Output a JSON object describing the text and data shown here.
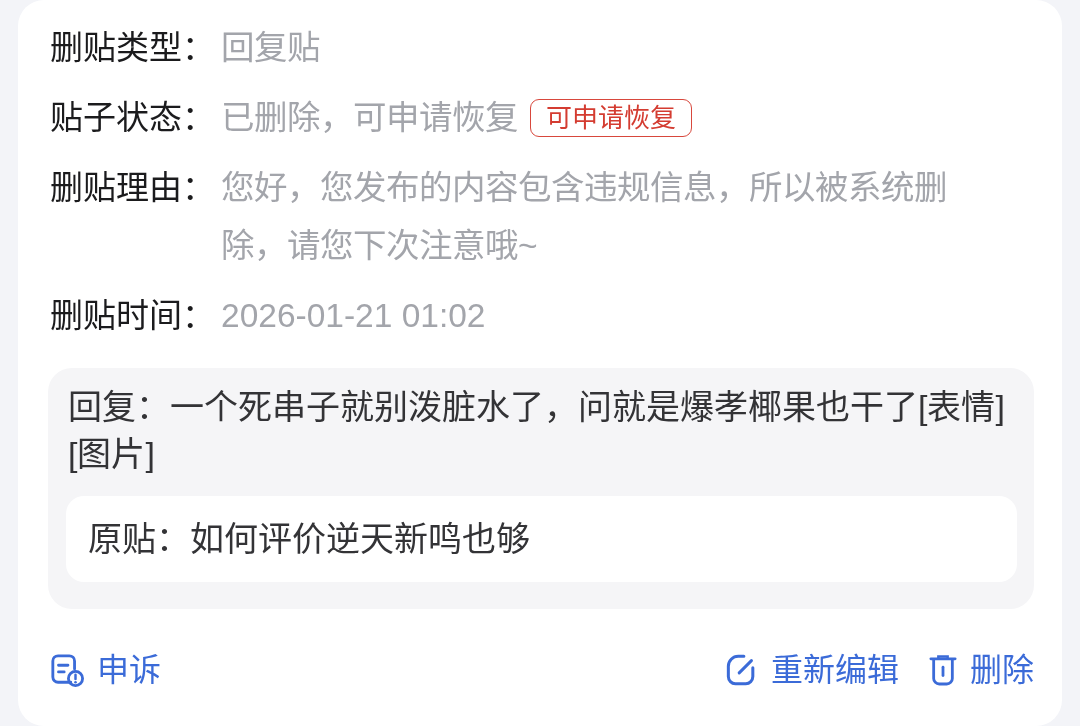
{
  "details": [
    {
      "label": "删贴类型：",
      "value": "回复贴"
    },
    {
      "label": "贴子状态：",
      "value": "已删除，可申请恢复",
      "badge": "可申请恢复"
    },
    {
      "label": "删贴理由：",
      "value": "您好，您发布的内容包含违规信息，所以被系统删除，请您下次注意哦~"
    },
    {
      "label": "删贴时间：",
      "value": "2026-01-21 01:02"
    }
  ],
  "reply": {
    "text": "回复：一个死串子就别泼脏水了，问就是爆孝椰果也干了[表情][图片]",
    "original_post": "原贴：如何评价逆天新鸣也够"
  },
  "actions": [
    {
      "kind": "appeal",
      "label": "申诉"
    },
    {
      "kind": "edit",
      "label": "重新编辑"
    },
    {
      "kind": "delete",
      "label": "删除"
    }
  ]
}
